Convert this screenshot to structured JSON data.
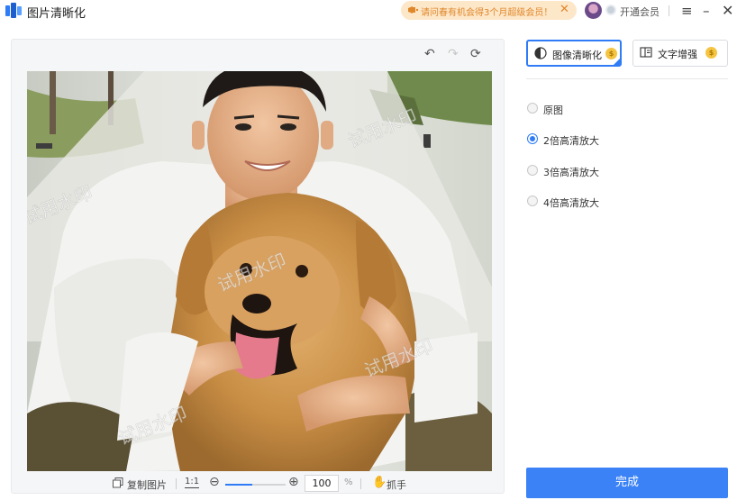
{
  "app": {
    "title": "图片清晰化"
  },
  "promo": {
    "text": "请问春有机会得3个月超级会员！",
    "close_glyph": "✕"
  },
  "account": {
    "vip_label": "开通会员"
  },
  "window_controls": {
    "menu_glyph": "≡",
    "minimize_glyph": "–",
    "close_glyph": "✕"
  },
  "canvas": {
    "undo_glyph": "↶",
    "redo_glyph": "↷",
    "reset_glyph": "⟳",
    "watermarks": [
      "试用水印",
      "试用水印",
      "试用水印",
      "试用水印",
      "试用水印"
    ]
  },
  "bottom_toolbar": {
    "copy_label": "复制图片",
    "one_to_one": "1:1",
    "zoom_out_glyph": "⊖",
    "zoom_in_glyph": "⊕",
    "zoom_value": "100",
    "zoom_unit": "%",
    "zoom_slider_fraction": 0.45,
    "hand_glyph": "✋",
    "hand_label": "抓手"
  },
  "tabs": [
    {
      "label": "图像清晰化",
      "active": true
    },
    {
      "label": "文字增强",
      "active": false
    }
  ],
  "coin_glyph": "$",
  "options": [
    {
      "label": "原图",
      "checked": false
    },
    {
      "label": "2倍高清放大",
      "checked": true
    },
    {
      "label": "3倍高清放大",
      "checked": false
    },
    {
      "label": "4倍高清放大",
      "checked": false
    }
  ],
  "done_label": "完成",
  "colors": {
    "accent": "#2f7cf6",
    "promo_bg": "#fde7c9",
    "promo_text": "#e0872a",
    "coin": "#f4c542"
  }
}
